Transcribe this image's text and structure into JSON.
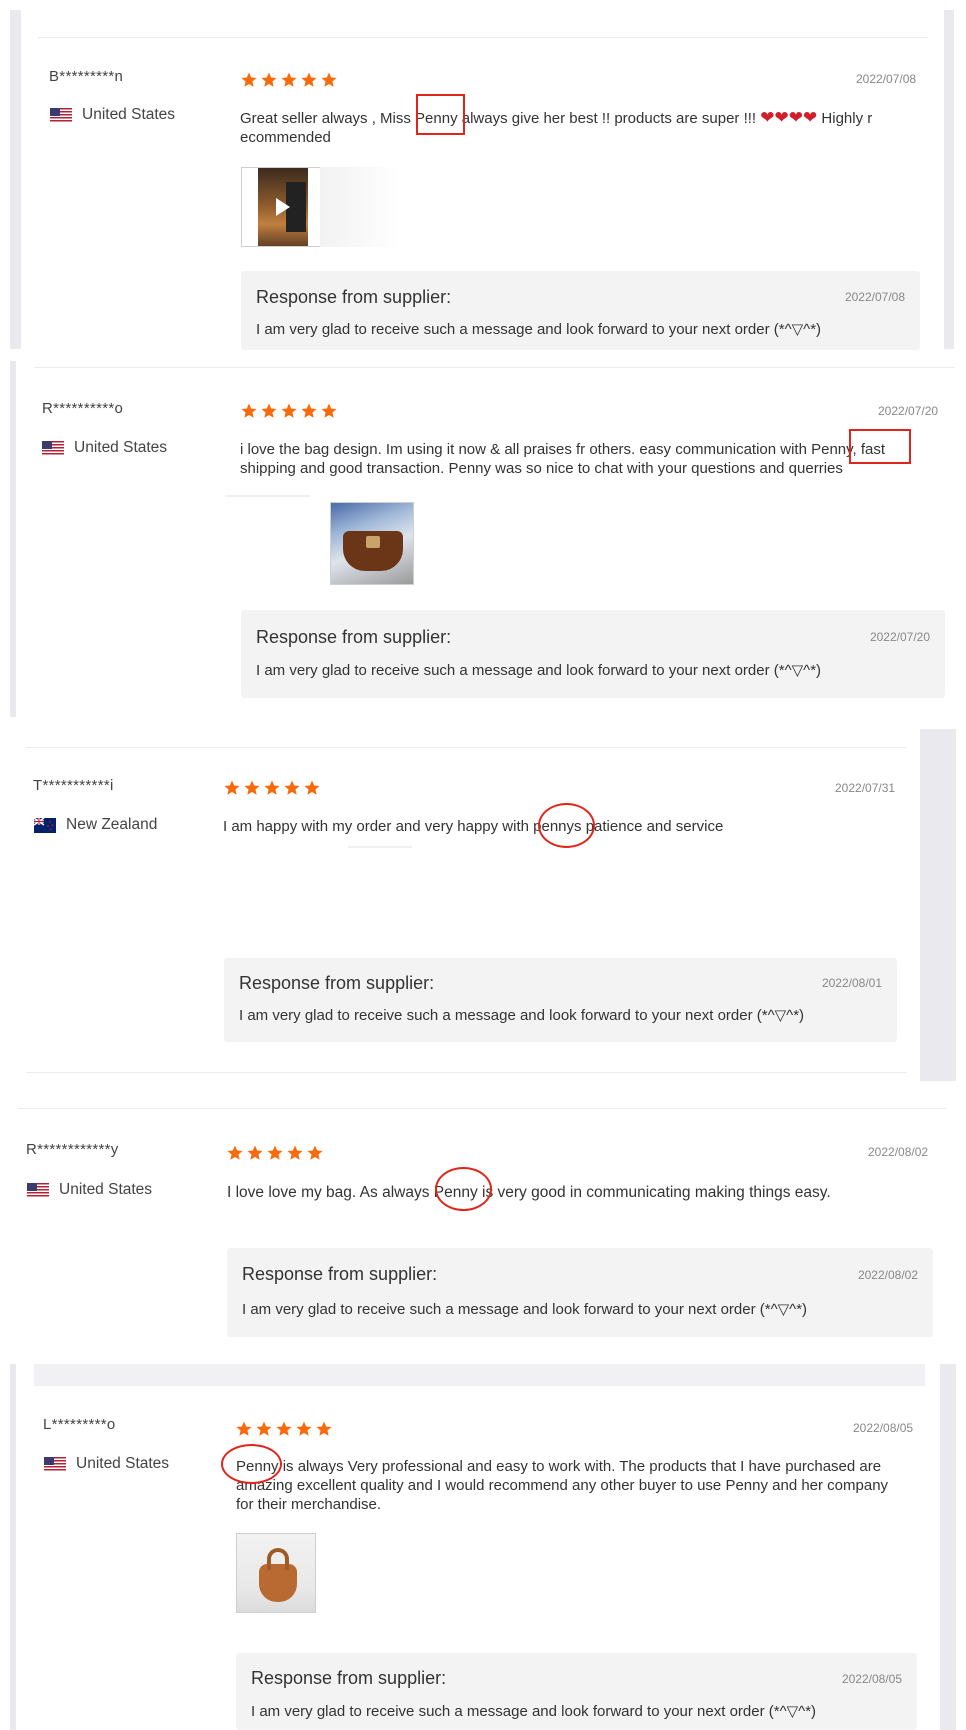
{
  "response_title": "Response from supplier:",
  "response_text": "I am very glad to receive such a message and look forward to your next order (*^▽^*)",
  "reviews": [
    {
      "buyer": "B*********n",
      "country": "United States",
      "date": "2022/07/08",
      "rating": 5,
      "comment_before": "Great seller always , Miss ",
      "highlight": "Penny",
      "comment_after": " always give her best !! products are super !!! ",
      "comment_tail": " Highly r",
      "comment_line2": "ecommended",
      "hearts": "❤❤❤❤",
      "response_date": "2022/07/08"
    },
    {
      "buyer": "R**********o",
      "country": "United States",
      "date": "2022/07/20",
      "rating": 5,
      "comment_before": "i love the bag design. Im using it now & all praises fr others. easy communication with ",
      "highlight": "Penny,",
      "comment_after": " fast",
      "comment_line2": "shipping and good transaction. Penny was so nice to chat with your questions and querries",
      "response_date": "2022/07/20"
    },
    {
      "buyer": "T***********i",
      "country": "New Zealand",
      "date": "2022/07/31",
      "rating": 5,
      "comment_before": "I am happy with my order and very happy with ",
      "highlight": "pennys",
      "comment_after": " patience and service",
      "response_date": "2022/08/01"
    },
    {
      "buyer": "R************y",
      "country": "United States",
      "date": "2022/08/02",
      "rating": 5,
      "comment_before": "I love love my bag. As always ",
      "highlight": "Penny",
      "comment_after": " is very good in communicating making things easy.",
      "response_date": "2022/08/02"
    },
    {
      "buyer": "L*********o",
      "country": "United States",
      "date": "2022/08/05",
      "rating": 5,
      "comment_before": "",
      "highlight": "Penny",
      "comment_after": " is always Very professional and easy to work with. The products that I have purchased are",
      "comment_line2": "amazing excellent quality and I would recommend any other buyer to use Penny and her company",
      "comment_line3": "for their merchandise.",
      "response_date": "2022/08/05"
    }
  ],
  "colors": {
    "star": "#f86a0c",
    "annotation": "#e0261b",
    "response_bg": "#f3f3f4"
  }
}
